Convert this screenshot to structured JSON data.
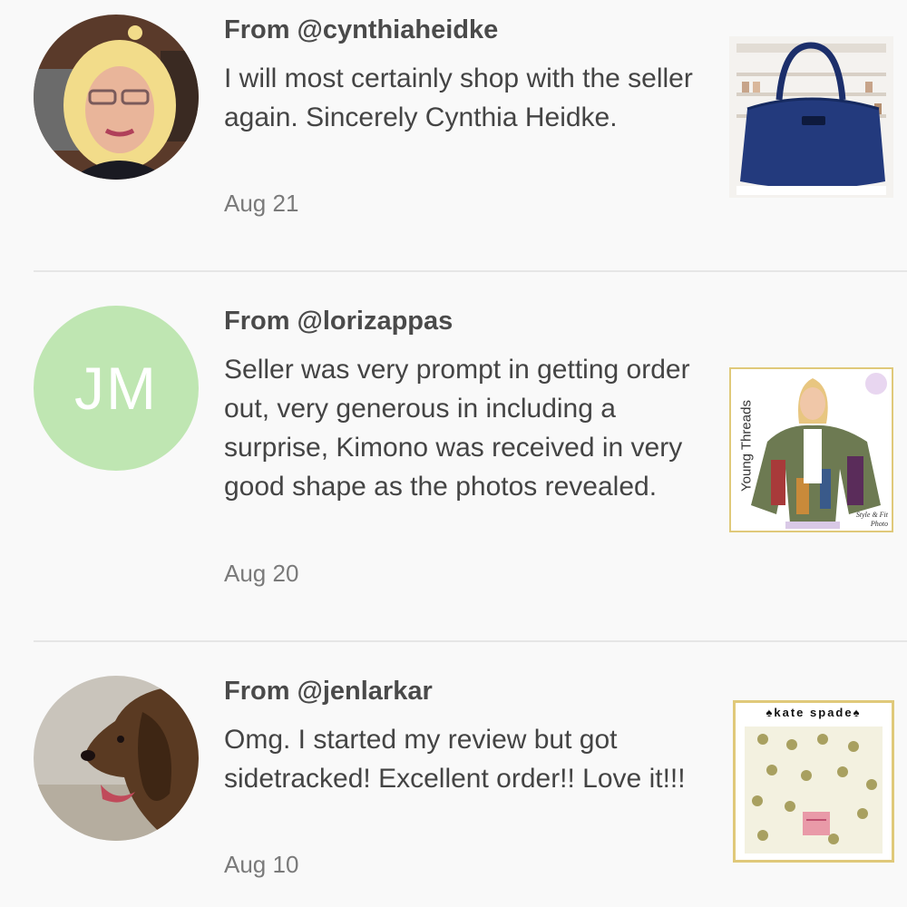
{
  "reviews": [
    {
      "from": "From @cynthiaheidke",
      "text": "I will most certainly shop with the seller again. Sincerely Cynthia Heidke.",
      "date": "Aug 21",
      "avatar_type": "photo-woman-blonde",
      "thumb_icon": "navy-handbag"
    },
    {
      "from": "From @lorizappas",
      "text": "Seller was very prompt in getting order out, very generous in including a surprise, Kimono was received in very good shape as the photos revealed.",
      "date": "Aug 20",
      "avatar_initials": "JM",
      "avatar_color": "#bfe6b2",
      "thumb_icon": "kimono-photo",
      "thumb_caption": "Young Threads",
      "thumb_corner": "Style & Fit Photo"
    },
    {
      "from": "From @jenlarkar",
      "text": "Omg. I started my review but got sidetracked! Excellent order!! Love it!!!",
      "date": "Aug 10",
      "avatar_type": "photo-dog",
      "thumb_icon": "kate-spade-folder",
      "thumb_brand": "♠kate spade♠"
    }
  ],
  "colors": {
    "background": "#f9f9f9",
    "username": "#4a4a4a",
    "text": "#444444",
    "date": "#7a7a7a",
    "divider": "#e6e6e6",
    "thumb_border": "#e0c97a"
  }
}
